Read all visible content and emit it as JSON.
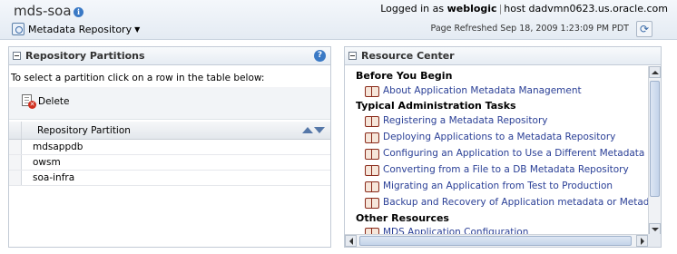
{
  "header": {
    "title": "mds-soa",
    "logged_in_prefix": "Logged in as",
    "user": "weblogic",
    "host_text": "host dadvmn0623.us.oracle.com",
    "target_menu_label": "Metadata Repository",
    "page_refreshed": "Page Refreshed Sep 18, 2009 1:23:09 PM PDT"
  },
  "repository_partitions": {
    "title": "Repository Partitions",
    "instruction": "To select a partition click on a row in the table below:",
    "delete_label": "Delete",
    "column_header": "Repository Partition",
    "rows": [
      "mdsappdb",
      "owsm",
      "soa-infra"
    ]
  },
  "resource_center": {
    "title": "Resource Center",
    "sections": [
      {
        "heading": "Before You Begin",
        "links": [
          "About Application Metadata Management"
        ]
      },
      {
        "heading": "Typical Administration Tasks",
        "links": [
          "Registering a Metadata Repository",
          "Deploying Applications to a Metadata Repository",
          "Configuring an Application to Use a Different Metadata Repo",
          "Converting from a File to a DB Metadata Repository",
          "Migrating an Application from Test to Production",
          "Backup and Recovery of Application metadata or Metadata I"
        ]
      },
      {
        "heading": "Other Resources",
        "links": [
          "MDS Application Configuration"
        ]
      }
    ]
  },
  "icons": {
    "info": "info-icon",
    "target_menu": "target-icon",
    "refresh": "refresh-icon",
    "collapse": "collapse-icon",
    "help": "help-icon",
    "delete": "delete-icon",
    "sort_ascending": "sort-ascending-icon",
    "sort_descending": "sort-descending-icon",
    "book": "book-icon"
  },
  "colors": {
    "link": "#2a3f96",
    "header_bg": "#e4ebf3",
    "accent": "#3a79c5"
  }
}
